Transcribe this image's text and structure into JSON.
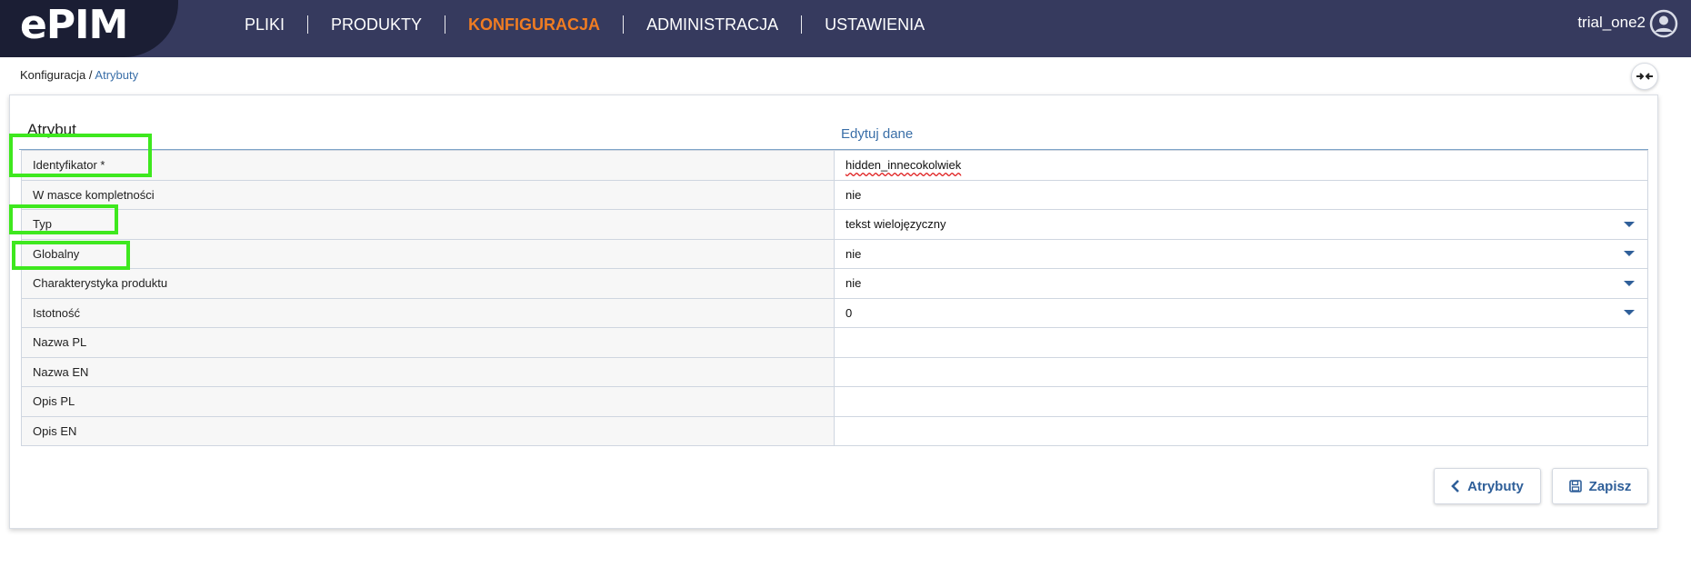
{
  "app": {
    "logo_text": "ePIM",
    "user_name": "trial_one2"
  },
  "nav": {
    "items": [
      "PLIKI",
      "PRODUKTY",
      "KONFIGURACJA",
      "ADMINISTRACJA",
      "USTAWIENIA"
    ],
    "active": "KONFIGURACJA"
  },
  "breadcrumb": {
    "root": "Konfiguracja",
    "separator": " / ",
    "current": "Atrybuty"
  },
  "panel": {
    "heading": "Atrybut",
    "edit_heading": "Edytuj dane"
  },
  "form": {
    "rows": [
      {
        "label": "Identyfikator *",
        "value": "hidden_innecokolwiek",
        "dropdown": false
      },
      {
        "label": "W masce kompletności",
        "value": "nie",
        "dropdown": false
      },
      {
        "label": "Typ",
        "value": "tekst wielojęzyczny",
        "dropdown": true
      },
      {
        "label": "Globalny",
        "value": "nie",
        "dropdown": true
      },
      {
        "label": "Charakterystyka produktu",
        "value": "nie",
        "dropdown": true
      },
      {
        "label": "Istotność",
        "value": "0",
        "dropdown": true
      },
      {
        "label": "Nazwa PL",
        "value": "",
        "dropdown": false
      },
      {
        "label": "Nazwa EN",
        "value": "",
        "dropdown": false
      },
      {
        "label": "Opis PL",
        "value": "",
        "dropdown": false
      },
      {
        "label": "Opis EN",
        "value": "",
        "dropdown": false
      }
    ]
  },
  "buttons": {
    "back_label": "Atrybuty",
    "save_label": "Zapisz"
  },
  "icons": {
    "avatar": "user-circle-icon",
    "collapse": "collapse-arrows-icon",
    "back": "chevron-left-icon",
    "save": "floppy-disk-icon"
  },
  "colors": {
    "topbar": "#363a5e",
    "accent": "#f07c22",
    "link": "#3a6fa8",
    "highlight": "#3ee81e"
  }
}
